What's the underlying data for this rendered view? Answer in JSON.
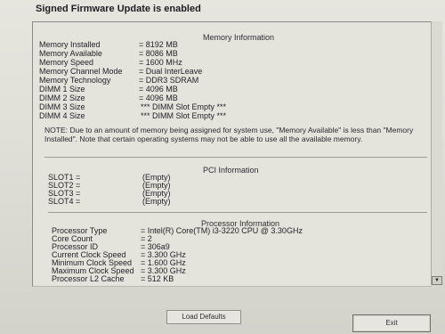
{
  "header": {
    "message": "Signed Firmware Update is enabled"
  },
  "memory": {
    "title": "Memory Information",
    "rows": [
      {
        "label": "Memory Installed",
        "value": "= 8192 MB"
      },
      {
        "label": "Memory Available",
        "value": "= 8086 MB"
      },
      {
        "label": "Memory Speed",
        "value": "= 1600 MHz"
      },
      {
        "label": "Memory Channel Mode",
        "value": "= Dual InterLeave"
      },
      {
        "label": "Memory Technology",
        "value": "= DDR3 SDRAM"
      },
      {
        "label": "DIMM 1 Size",
        "value": "= 4096 MB"
      },
      {
        "label": "DIMM 2 Size",
        "value": "= 4096 MB"
      },
      {
        "label": "DIMM 3 Size",
        "value": "*** DIMM Slot Empty ***"
      },
      {
        "label": "DIMM 4 Size",
        "value": "*** DIMM Slot Empty ***"
      }
    ],
    "note": "NOTE: Due to an amount of memory being assigned for system use, \"Memory Available\" is less than \"Memory Installed\". Note that certain operating systems may not be able to use all the available memory."
  },
  "pci": {
    "title": "PCI Information",
    "rows": [
      {
        "label": "SLOT1 =",
        "value": "(Empty)"
      },
      {
        "label": "SLOT2 =",
        "value": "(Empty)"
      },
      {
        "label": "SLOT3 =",
        "value": "(Empty)"
      },
      {
        "label": "SLOT4 =",
        "value": "(Empty)"
      }
    ]
  },
  "processor": {
    "title": "Processor Information",
    "rows": [
      {
        "label": "Processor Type",
        "value": "= Intel(R) Core(TM) i3-3220 CPU @ 3.30GHz"
      },
      {
        "label": "Core Count",
        "value": "= 2"
      },
      {
        "label": "Processor ID",
        "value": "= 306a9"
      },
      {
        "label": "Current Clock Speed",
        "value": "= 3.300 GHz"
      },
      {
        "label": "Minimum Clock Speed",
        "value": "= 1.600 GHz"
      },
      {
        "label": "Maximum Clock Speed",
        "value": "= 3.300 GHz"
      },
      {
        "label": "Processor L2 Cache",
        "value": "= 512 KB"
      }
    ]
  },
  "buttons": {
    "load_defaults": "Load Defaults",
    "exit": "Exit"
  },
  "scrollbar": {
    "down_arrow": "▼"
  }
}
